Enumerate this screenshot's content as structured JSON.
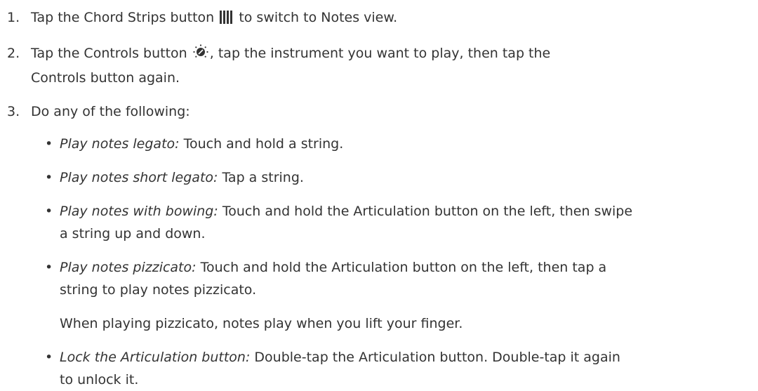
{
  "steps": [
    {
      "number": "1.",
      "before_icon": "Tap the Chord Strips button",
      "icon": "chord-strips-icon",
      "after_icon": "to switch to Notes view."
    },
    {
      "number": "2.",
      "before_icon": "Tap the Controls button",
      "icon": "controls-knob-icon",
      "after_icon": ", tap the instrument you want to play, then tap the Controls button again."
    },
    {
      "number": "3.",
      "text": "Do any of the following:"
    }
  ],
  "bullets": [
    {
      "term": "Play notes legato:",
      "text": "Touch and hold a string."
    },
    {
      "term": "Play notes short legato:",
      "text": "Tap a string."
    },
    {
      "term": "Play notes with bowing:",
      "text": "Touch and hold the Articulation button on the left, then swipe a string up and down."
    },
    {
      "term": "Play notes pizzicato:",
      "text": "Touch and hold the Articulation button on the left, then tap a string to play notes pizzicato.",
      "note": "When playing pizzicato, notes play when you lift your finger."
    },
    {
      "term": "Lock the Articulation button:",
      "text": "Double-tap the Articulation button. Double-tap it again to unlock it."
    }
  ],
  "bullet_glyph": "•",
  "colors": {
    "text": "#333333"
  }
}
